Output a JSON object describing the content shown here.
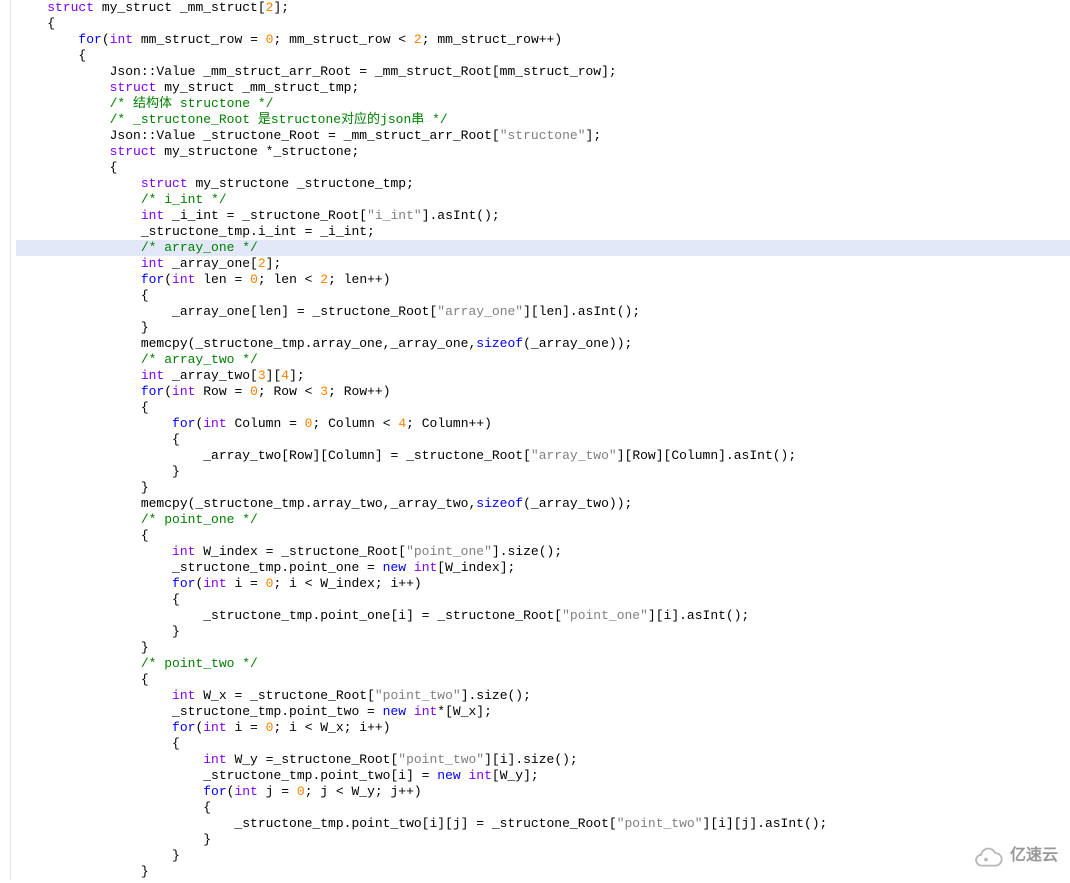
{
  "code_lines": [
    {
      "indent": 0,
      "tokens": [
        {
          "t": "typ",
          "v": "struct"
        },
        {
          "t": "p",
          "v": " my_struct _mm_struct["
        },
        {
          "t": "num",
          "v": "2"
        },
        {
          "t": "p",
          "v": "];"
        }
      ]
    },
    {
      "indent": 0,
      "tokens": [
        {
          "t": "p",
          "v": "{"
        }
      ]
    },
    {
      "indent": 1,
      "tokens": [
        {
          "t": "kw",
          "v": "for"
        },
        {
          "t": "p",
          "v": "("
        },
        {
          "t": "typ",
          "v": "int"
        },
        {
          "t": "p",
          "v": " mm_struct_row = "
        },
        {
          "t": "num",
          "v": "0"
        },
        {
          "t": "p",
          "v": "; mm_struct_row < "
        },
        {
          "t": "num",
          "v": "2"
        },
        {
          "t": "p",
          "v": "; mm_struct_row++)"
        }
      ]
    },
    {
      "indent": 1,
      "tokens": [
        {
          "t": "p",
          "v": "{"
        }
      ]
    },
    {
      "indent": 2,
      "tokens": [
        {
          "t": "p",
          "v": "Json::Value _mm_struct_arr_Root = _mm_struct_Root[mm_struct_row];"
        }
      ]
    },
    {
      "indent": 2,
      "tokens": [
        {
          "t": "typ",
          "v": "struct"
        },
        {
          "t": "p",
          "v": " my_struct _mm_struct_tmp;"
        }
      ]
    },
    {
      "indent": 2,
      "tokens": [
        {
          "t": "cmt",
          "v": "/* 结构体 structone */"
        }
      ]
    },
    {
      "indent": 2,
      "tokens": [
        {
          "t": "cmt",
          "v": "/* _structone_Root 是structone对应的json串 */"
        }
      ]
    },
    {
      "indent": 2,
      "tokens": [
        {
          "t": "p",
          "v": "Json::Value _structone_Root = _mm_struct_arr_Root["
        },
        {
          "t": "str",
          "v": "\"structone\""
        },
        {
          "t": "p",
          "v": "];"
        }
      ]
    },
    {
      "indent": 2,
      "tokens": [
        {
          "t": "typ",
          "v": "struct"
        },
        {
          "t": "p",
          "v": " my_structone *_structone;"
        }
      ]
    },
    {
      "indent": 2,
      "tokens": [
        {
          "t": "p",
          "v": "{"
        }
      ]
    },
    {
      "indent": 3,
      "tokens": [
        {
          "t": "typ",
          "v": "struct"
        },
        {
          "t": "p",
          "v": " my_structone _structone_tmp;"
        }
      ]
    },
    {
      "indent": 3,
      "tokens": [
        {
          "t": "cmt",
          "v": "/* i_int */"
        }
      ]
    },
    {
      "indent": 3,
      "tokens": [
        {
          "t": "typ",
          "v": "int"
        },
        {
          "t": "p",
          "v": " _i_int = _structone_Root["
        },
        {
          "t": "str",
          "v": "\"i_int\""
        },
        {
          "t": "p",
          "v": "].asInt();"
        }
      ]
    },
    {
      "indent": 3,
      "tokens": [
        {
          "t": "p",
          "v": "_structone_tmp.i_int = _i_int;"
        }
      ]
    },
    {
      "indent": 3,
      "hl": true,
      "tokens": [
        {
          "t": "cmt",
          "v": "/* array_one */"
        }
      ]
    },
    {
      "indent": 3,
      "tokens": [
        {
          "t": "typ",
          "v": "int"
        },
        {
          "t": "p",
          "v": " _array_one["
        },
        {
          "t": "num",
          "v": "2"
        },
        {
          "t": "p",
          "v": "];"
        }
      ]
    },
    {
      "indent": 3,
      "tokens": [
        {
          "t": "kw",
          "v": "for"
        },
        {
          "t": "p",
          "v": "("
        },
        {
          "t": "typ",
          "v": "int"
        },
        {
          "t": "p",
          "v": " len = "
        },
        {
          "t": "num",
          "v": "0"
        },
        {
          "t": "p",
          "v": "; len < "
        },
        {
          "t": "num",
          "v": "2"
        },
        {
          "t": "p",
          "v": "; len++)"
        }
      ]
    },
    {
      "indent": 3,
      "tokens": [
        {
          "t": "p",
          "v": "{"
        }
      ]
    },
    {
      "indent": 4,
      "tokens": [
        {
          "t": "p",
          "v": "_array_one[len] = _structone_Root["
        },
        {
          "t": "str",
          "v": "\"array_one\""
        },
        {
          "t": "p",
          "v": "][len].asInt();"
        }
      ]
    },
    {
      "indent": 3,
      "tokens": [
        {
          "t": "p",
          "v": "}"
        }
      ]
    },
    {
      "indent": 3,
      "tokens": [
        {
          "t": "p",
          "v": "memcpy(_structone_tmp.array_one,_array_one,"
        },
        {
          "t": "kw",
          "v": "sizeof"
        },
        {
          "t": "p",
          "v": "(_array_one));"
        }
      ]
    },
    {
      "indent": 3,
      "tokens": [
        {
          "t": "cmt",
          "v": "/* array_two */"
        }
      ]
    },
    {
      "indent": 3,
      "tokens": [
        {
          "t": "typ",
          "v": "int"
        },
        {
          "t": "p",
          "v": " _array_two["
        },
        {
          "t": "num",
          "v": "3"
        },
        {
          "t": "p",
          "v": "]["
        },
        {
          "t": "num",
          "v": "4"
        },
        {
          "t": "p",
          "v": "];"
        }
      ]
    },
    {
      "indent": 3,
      "tokens": [
        {
          "t": "kw",
          "v": "for"
        },
        {
          "t": "p",
          "v": "("
        },
        {
          "t": "typ",
          "v": "int"
        },
        {
          "t": "p",
          "v": " Row = "
        },
        {
          "t": "num",
          "v": "0"
        },
        {
          "t": "p",
          "v": "; Row < "
        },
        {
          "t": "num",
          "v": "3"
        },
        {
          "t": "p",
          "v": "; Row++)"
        }
      ]
    },
    {
      "indent": 3,
      "tokens": [
        {
          "t": "p",
          "v": "{"
        }
      ]
    },
    {
      "indent": 4,
      "tokens": [
        {
          "t": "kw",
          "v": "for"
        },
        {
          "t": "p",
          "v": "("
        },
        {
          "t": "typ",
          "v": "int"
        },
        {
          "t": "p",
          "v": " Column = "
        },
        {
          "t": "num",
          "v": "0"
        },
        {
          "t": "p",
          "v": "; Column < "
        },
        {
          "t": "num",
          "v": "4"
        },
        {
          "t": "p",
          "v": "; Column++)"
        }
      ]
    },
    {
      "indent": 4,
      "tokens": [
        {
          "t": "p",
          "v": "{"
        }
      ]
    },
    {
      "indent": 5,
      "tokens": [
        {
          "t": "p",
          "v": "_array_two[Row][Column] = _structone_Root["
        },
        {
          "t": "str",
          "v": "\"array_two\""
        },
        {
          "t": "p",
          "v": "][Row][Column].asInt();"
        }
      ]
    },
    {
      "indent": 4,
      "tokens": [
        {
          "t": "p",
          "v": "}"
        }
      ]
    },
    {
      "indent": 3,
      "tokens": [
        {
          "t": "p",
          "v": "}"
        }
      ]
    },
    {
      "indent": 3,
      "tokens": [
        {
          "t": "p",
          "v": "memcpy(_structone_tmp.array_two,_array_two,"
        },
        {
          "t": "kw",
          "v": "sizeof"
        },
        {
          "t": "p",
          "v": "(_array_two));"
        }
      ]
    },
    {
      "indent": 3,
      "tokens": [
        {
          "t": "cmt",
          "v": "/* point_one */"
        }
      ]
    },
    {
      "indent": 3,
      "tokens": [
        {
          "t": "p",
          "v": "{"
        }
      ]
    },
    {
      "indent": 4,
      "tokens": [
        {
          "t": "typ",
          "v": "int"
        },
        {
          "t": "p",
          "v": " W_index = _structone_Root["
        },
        {
          "t": "str",
          "v": "\"point_one\""
        },
        {
          "t": "p",
          "v": "].size();"
        }
      ]
    },
    {
      "indent": 4,
      "tokens": [
        {
          "t": "p",
          "v": "_structone_tmp.point_one = "
        },
        {
          "t": "kw",
          "v": "new"
        },
        {
          "t": "p",
          "v": " "
        },
        {
          "t": "typ",
          "v": "int"
        },
        {
          "t": "p",
          "v": "[W_index];"
        }
      ]
    },
    {
      "indent": 4,
      "tokens": [
        {
          "t": "kw",
          "v": "for"
        },
        {
          "t": "p",
          "v": "("
        },
        {
          "t": "typ",
          "v": "int"
        },
        {
          "t": "p",
          "v": " i = "
        },
        {
          "t": "num",
          "v": "0"
        },
        {
          "t": "p",
          "v": "; i < W_index; i++)"
        }
      ]
    },
    {
      "indent": 4,
      "tokens": [
        {
          "t": "p",
          "v": "{"
        }
      ]
    },
    {
      "indent": 5,
      "tokens": [
        {
          "t": "p",
          "v": "_structone_tmp.point_one[i] = _structone_Root["
        },
        {
          "t": "str",
          "v": "\"point_one\""
        },
        {
          "t": "p",
          "v": "][i].asInt();"
        }
      ]
    },
    {
      "indent": 4,
      "tokens": [
        {
          "t": "p",
          "v": "}"
        }
      ]
    },
    {
      "indent": 3,
      "tokens": [
        {
          "t": "p",
          "v": "}"
        }
      ]
    },
    {
      "indent": 3,
      "tokens": [
        {
          "t": "cmt",
          "v": "/* point_two */"
        }
      ]
    },
    {
      "indent": 3,
      "tokens": [
        {
          "t": "p",
          "v": "{"
        }
      ]
    },
    {
      "indent": 4,
      "tokens": [
        {
          "t": "typ",
          "v": "int"
        },
        {
          "t": "p",
          "v": " W_x = _structone_Root["
        },
        {
          "t": "str",
          "v": "\"point_two\""
        },
        {
          "t": "p",
          "v": "].size();"
        }
      ]
    },
    {
      "indent": 4,
      "tokens": [
        {
          "t": "p",
          "v": "_structone_tmp.point_two = "
        },
        {
          "t": "kw",
          "v": "new"
        },
        {
          "t": "p",
          "v": " "
        },
        {
          "t": "typ",
          "v": "int"
        },
        {
          "t": "p",
          "v": "*[W_x];"
        }
      ]
    },
    {
      "indent": 4,
      "tokens": [
        {
          "t": "kw",
          "v": "for"
        },
        {
          "t": "p",
          "v": "("
        },
        {
          "t": "typ",
          "v": "int"
        },
        {
          "t": "p",
          "v": " i = "
        },
        {
          "t": "num",
          "v": "0"
        },
        {
          "t": "p",
          "v": "; i < W_x; i++)"
        }
      ]
    },
    {
      "indent": 4,
      "tokens": [
        {
          "t": "p",
          "v": "{"
        }
      ]
    },
    {
      "indent": 5,
      "tokens": [
        {
          "t": "typ",
          "v": "int"
        },
        {
          "t": "p",
          "v": " W_y =_structone_Root["
        },
        {
          "t": "str",
          "v": "\"point_two\""
        },
        {
          "t": "p",
          "v": "][i].size();"
        }
      ]
    },
    {
      "indent": 5,
      "tokens": [
        {
          "t": "p",
          "v": "_structone_tmp.point_two[i] = "
        },
        {
          "t": "kw",
          "v": "new"
        },
        {
          "t": "p",
          "v": " "
        },
        {
          "t": "typ",
          "v": "int"
        },
        {
          "t": "p",
          "v": "[W_y];"
        }
      ]
    },
    {
      "indent": 5,
      "tokens": [
        {
          "t": "kw",
          "v": "for"
        },
        {
          "t": "p",
          "v": "("
        },
        {
          "t": "typ",
          "v": "int"
        },
        {
          "t": "p",
          "v": " j = "
        },
        {
          "t": "num",
          "v": "0"
        },
        {
          "t": "p",
          "v": "; j < W_y; j++)"
        }
      ]
    },
    {
      "indent": 5,
      "tokens": [
        {
          "t": "p",
          "v": "{"
        }
      ]
    },
    {
      "indent": 6,
      "tokens": [
        {
          "t": "p",
          "v": "_structone_tmp.point_two[i][j] = _structone_Root["
        },
        {
          "t": "str",
          "v": "\"point_two\""
        },
        {
          "t": "p",
          "v": "][i][j].asInt();"
        }
      ]
    },
    {
      "indent": 5,
      "tokens": [
        {
          "t": "p",
          "v": "}"
        }
      ]
    },
    {
      "indent": 4,
      "tokens": [
        {
          "t": "p",
          "v": "}"
        }
      ]
    },
    {
      "indent": 3,
      "tokens": [
        {
          "t": "p",
          "v": "}"
        }
      ]
    }
  ],
  "logo_text": "亿速云"
}
